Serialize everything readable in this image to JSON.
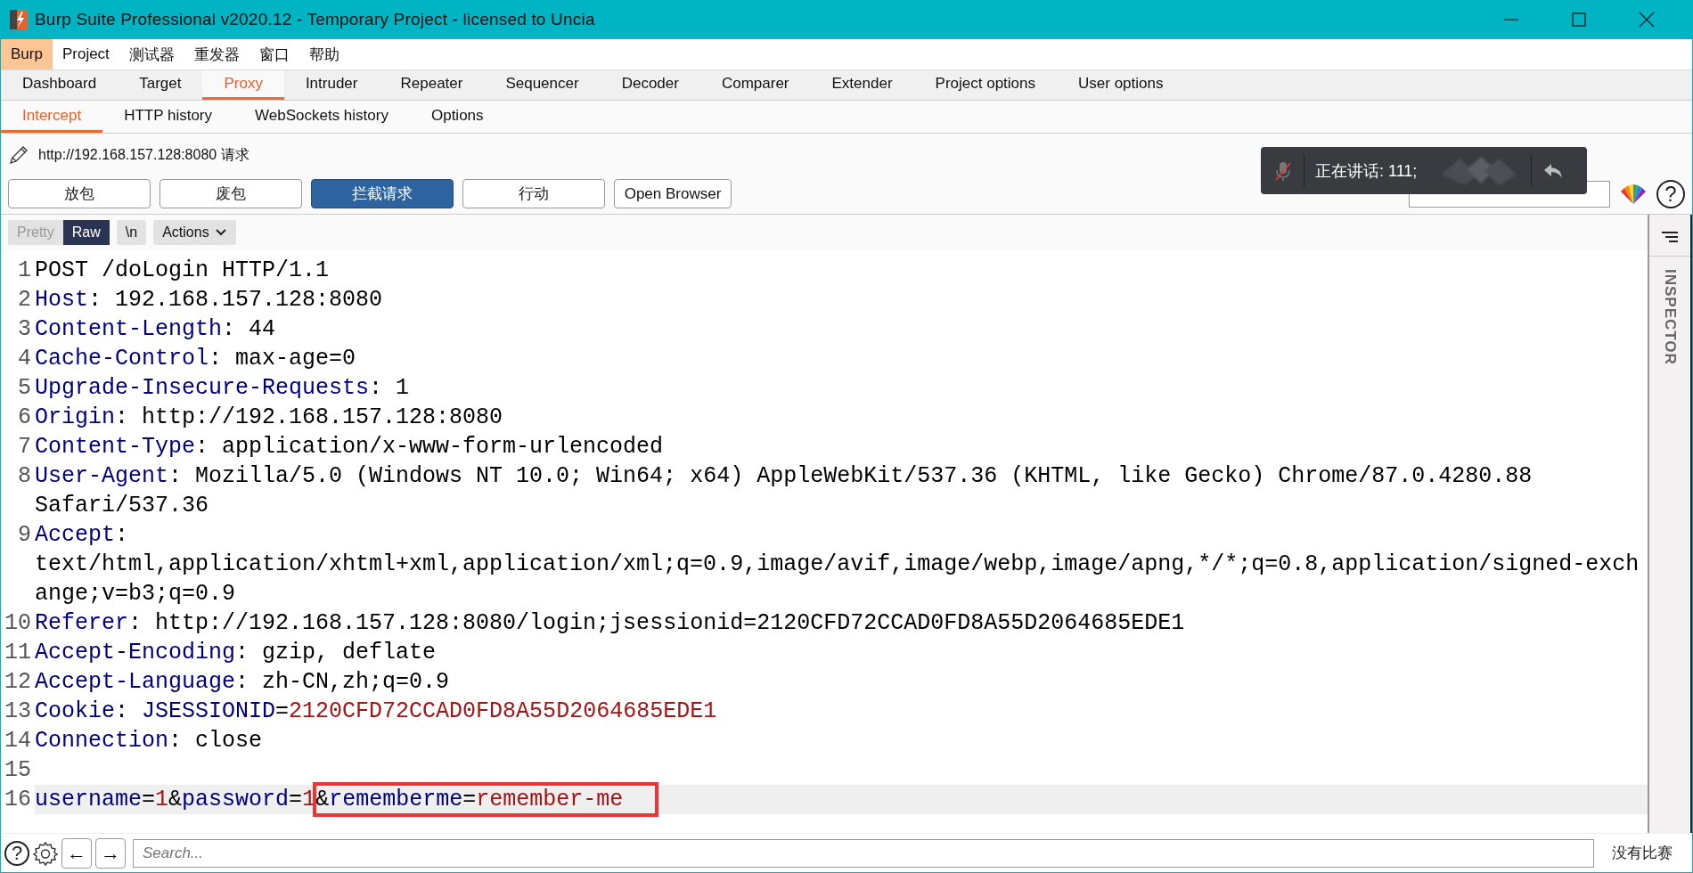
{
  "window": {
    "title": "Burp Suite Professional v2020.12 - Temporary Project - licensed to Uncia"
  },
  "menu": [
    {
      "label": "Burp",
      "selected": true
    },
    {
      "label": "Project",
      "selected": false
    },
    {
      "label": "测试器",
      "selected": false
    },
    {
      "label": "重发器",
      "selected": false
    },
    {
      "label": "窗口",
      "selected": false
    },
    {
      "label": "帮助",
      "selected": false
    }
  ],
  "tabs": [
    {
      "label": "Dashboard",
      "selected": false
    },
    {
      "label": "Target",
      "selected": false
    },
    {
      "label": "Proxy",
      "selected": true
    },
    {
      "label": "Intruder",
      "selected": false
    },
    {
      "label": "Repeater",
      "selected": false
    },
    {
      "label": "Sequencer",
      "selected": false
    },
    {
      "label": "Decoder",
      "selected": false
    },
    {
      "label": "Comparer",
      "selected": false
    },
    {
      "label": "Extender",
      "selected": false
    },
    {
      "label": "Project options",
      "selected": false
    },
    {
      "label": "User options",
      "selected": false
    }
  ],
  "subtabs": [
    {
      "label": "Intercept",
      "selected": true
    },
    {
      "label": "HTTP history",
      "selected": false
    },
    {
      "label": "WebSockets history",
      "selected": false
    },
    {
      "label": "Options",
      "selected": false
    }
  ],
  "intercept": {
    "target": "http://192.168.157.128:8080 请求",
    "buttons": [
      {
        "label": "放包",
        "on": false
      },
      {
        "label": "废包",
        "on": false
      },
      {
        "label": "拦截请求",
        "on": true
      },
      {
        "label": "行动",
        "on": false
      },
      {
        "label": "Open Browser",
        "on": false
      }
    ],
    "help": "?"
  },
  "toast": {
    "text": "正在讲话: 111;"
  },
  "editor": {
    "view_modes": [
      {
        "label": "Pretty",
        "selected": false
      },
      {
        "label": "Raw",
        "selected": true
      }
    ],
    "newline_button": "\\n",
    "actions_button": "Actions",
    "lines": [
      {
        "number": "1",
        "highlighted": false,
        "rows": [
          [
            {
              "kind": "value",
              "text": "POST /doLogin HTTP/1.1"
            }
          ]
        ]
      },
      {
        "number": "2",
        "highlighted": false,
        "rows": [
          [
            {
              "kind": "name",
              "text": "Host"
            },
            {
              "kind": "value",
              "text": ": 192.168.157.128:8080"
            }
          ]
        ]
      },
      {
        "number": "3",
        "highlighted": false,
        "rows": [
          [
            {
              "kind": "name",
              "text": "Content-Length"
            },
            {
              "kind": "value",
              "text": ": 44"
            }
          ]
        ]
      },
      {
        "number": "4",
        "highlighted": false,
        "rows": [
          [
            {
              "kind": "name",
              "text": "Cache-Control"
            },
            {
              "kind": "value",
              "text": ": max-age=0"
            }
          ]
        ]
      },
      {
        "number": "5",
        "highlighted": false,
        "rows": [
          [
            {
              "kind": "name",
              "text": "Upgrade-Insecure-Requests"
            },
            {
              "kind": "value",
              "text": ": 1"
            }
          ]
        ]
      },
      {
        "number": "6",
        "highlighted": false,
        "rows": [
          [
            {
              "kind": "name",
              "text": "Origin"
            },
            {
              "kind": "value",
              "text": ": http://192.168.157.128:8080"
            }
          ]
        ]
      },
      {
        "number": "7",
        "highlighted": false,
        "rows": [
          [
            {
              "kind": "name",
              "text": "Content-Type"
            },
            {
              "kind": "value",
              "text": ": application/x-www-form-urlencoded"
            }
          ]
        ]
      },
      {
        "number": "8",
        "highlighted": false,
        "rows": [
          [
            {
              "kind": "name",
              "text": "User-Agent"
            },
            {
              "kind": "value",
              "text": ": Mozilla/5.0 (Windows NT 10.0; Win64; x64) AppleWebKit/537.36 (KHTML, like Gecko) Chrome/87.0.4280.88"
            }
          ],
          [
            {
              "kind": "value",
              "text": "Safari/537.36"
            }
          ]
        ]
      },
      {
        "number": "9",
        "highlighted": false,
        "rows": [
          [
            {
              "kind": "name",
              "text": "Accept"
            },
            {
              "kind": "value",
              "text": ":"
            }
          ],
          [
            {
              "kind": "value",
              "text": "text/html,application/xhtml+xml,application/xml;q=0.9,image/avif,image/webp,image/apng,*/*;q=0.8,application/signed-exch"
            }
          ],
          [
            {
              "kind": "value",
              "text": "ange;v=b3;q=0.9"
            }
          ]
        ]
      },
      {
        "number": "10",
        "highlighted": false,
        "rows": [
          [
            {
              "kind": "name",
              "text": "Referer"
            },
            {
              "kind": "value",
              "text": ": http://192.168.157.128:8080/login;jsessionid=2120CFD72CCAD0FD8A55D2064685EDE1"
            }
          ]
        ]
      },
      {
        "number": "11",
        "highlighted": false,
        "rows": [
          [
            {
              "kind": "name",
              "text": "Accept-Encoding"
            },
            {
              "kind": "value",
              "text": ": gzip, deflate"
            }
          ]
        ]
      },
      {
        "number": "12",
        "highlighted": false,
        "rows": [
          [
            {
              "kind": "name",
              "text": "Accept-Language"
            },
            {
              "kind": "value",
              "text": ": zh-CN,zh;q=0.9"
            }
          ]
        ]
      },
      {
        "number": "13",
        "highlighted": false,
        "rows": [
          [
            {
              "kind": "name",
              "text": "Cookie"
            },
            {
              "kind": "value",
              "text": ": "
            },
            {
              "kind": "name",
              "text": "JSESSIONID"
            },
            {
              "kind": "value",
              "text": "="
            },
            {
              "kind": "param-value",
              "text": "2120CFD72CCAD0FD8A55D2064685EDE1"
            }
          ]
        ]
      },
      {
        "number": "14",
        "highlighted": false,
        "rows": [
          [
            {
              "kind": "name",
              "text": "Connection"
            },
            {
              "kind": "value",
              "text": ": close"
            }
          ]
        ]
      },
      {
        "number": "15",
        "highlighted": false
      },
      {
        "number": "16",
        "highlighted": true,
        "boxed": true,
        "rows": [
          [
            {
              "kind": "name",
              "text": "username"
            },
            {
              "kind": "value",
              "text": "="
            },
            {
              "kind": "param-value",
              "text": "1"
            },
            {
              "kind": "value",
              "text": "&"
            },
            {
              "kind": "name",
              "text": "password"
            },
            {
              "kind": "value",
              "text": "="
            },
            {
              "kind": "param-value",
              "text": "1"
            },
            {
              "kind": "value",
              "text": "&"
            },
            {
              "kind": "name",
              "text": "rememberme"
            },
            {
              "kind": "value",
              "text": "="
            },
            {
              "kind": "param-value",
              "text": "remember-me"
            }
          ]
        ]
      }
    ]
  },
  "inspector": {
    "label": "INSPECTOR"
  },
  "footer": {
    "help": "?",
    "back": "←",
    "forward": "→",
    "search": {
      "placeholder": "Search..."
    },
    "matches": "没有比赛"
  }
}
